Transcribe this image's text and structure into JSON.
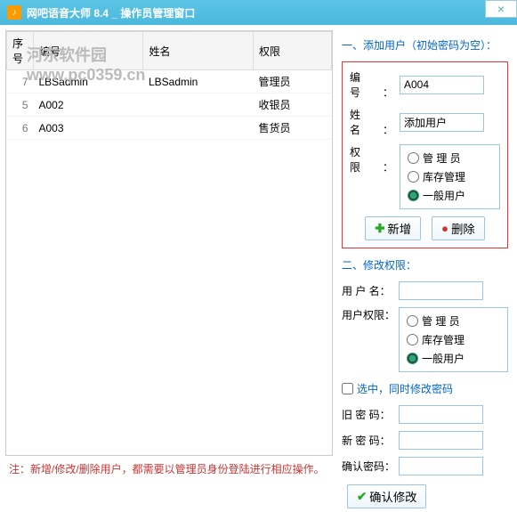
{
  "title": "网吧语音大师 8.4 _ 操作员管理窗口",
  "watermark": "河东软件园\nwww.pc0359.cn",
  "table": {
    "headers": [
      "序号",
      "编号",
      "姓名",
      "权限"
    ],
    "rows": [
      {
        "n": "7",
        "id": "LBSadmin",
        "name": "LBSadmin",
        "role": "管理员"
      },
      {
        "n": "5",
        "id": "A002",
        "name": "",
        "role": "收银员"
      },
      {
        "n": "6",
        "id": "A003",
        "name": "",
        "role": "售货员"
      }
    ]
  },
  "add": {
    "title": "一、添加用户（初始密码为空）：",
    "id_label": "编　号：",
    "id_value": "A004",
    "name_label": "姓　名：",
    "name_value": "添加用户",
    "role_label": "权　限：",
    "roles": {
      "admin": "管 理 员",
      "stock": "库存管理",
      "normal": "一般用户"
    },
    "add_btn": "新增",
    "del_btn": "删除"
  },
  "mod": {
    "title": "二、修改权限：",
    "user_label": "用 户 名：",
    "role_label": "用户权限：",
    "chk": "选中，同时修改密码",
    "old": "旧 密 码：",
    "new": "新 密 码：",
    "cfm": "确认密码：",
    "confirm": "确认修改"
  },
  "note": "注：新增/修改/删除用户，都需要以管理员身份登陆进行相应操作。"
}
